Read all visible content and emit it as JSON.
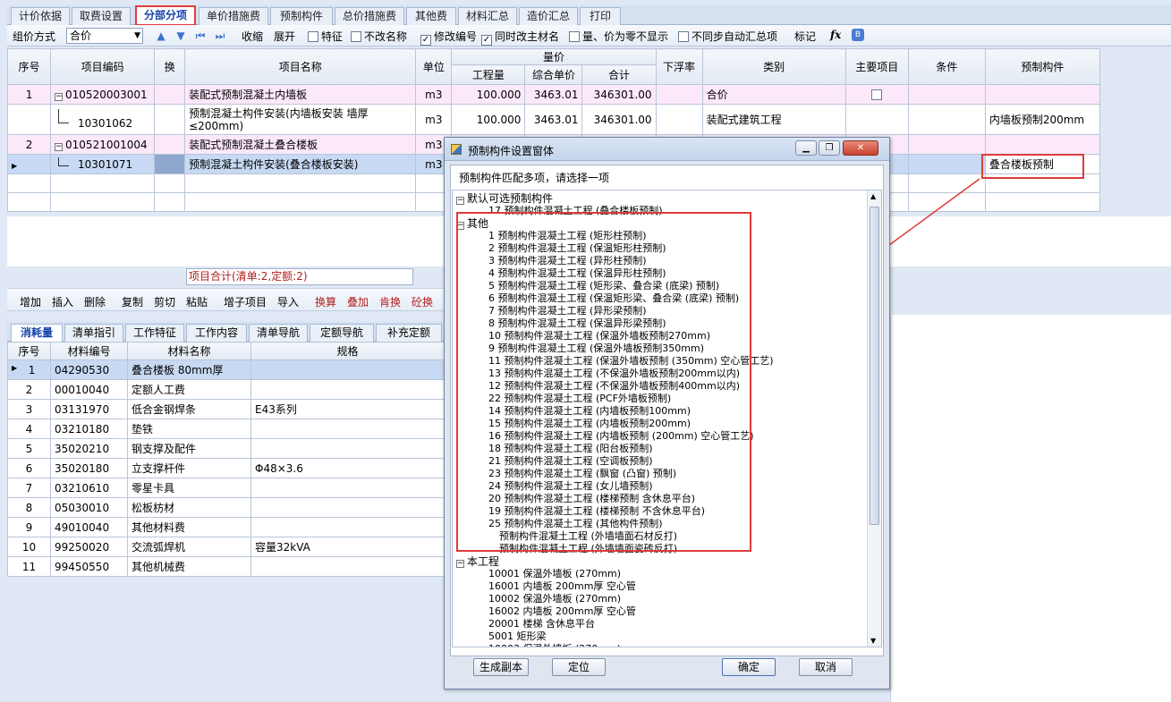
{
  "tabs": [
    "计价依据",
    "取费设置",
    "分部分项",
    "单价措施费",
    "预制构件",
    "总价措施费",
    "其他费",
    "材料汇总",
    "造价汇总",
    "打印"
  ],
  "active_tab": "分部分项",
  "toolbar": {
    "group_label": "组价方式",
    "group_value": "合价",
    "collapse": "收缩",
    "expand": "展开",
    "chk_feature": "特征",
    "chk_nochange_name": "不改名称",
    "chk_modify_code": "修改编号",
    "chk_modify_main": "同时改主材名",
    "chk_zero_hide": "量、价为零不显示",
    "chk_nosync": "不同步自动汇总项",
    "mark": "标记",
    "fx": "fx"
  },
  "grid": {
    "headers": {
      "seq": "序号",
      "code": "项目编码",
      "swap": "换",
      "name": "项目名称",
      "unit": "单位",
      "qty_group": "量价",
      "qty": "工程量",
      "price": "综合单价",
      "total": "合计",
      "float": "下浮率",
      "category": "类别",
      "main": "主要项目",
      "cond": "条件",
      "prefab": "预制构件"
    },
    "rows": [
      {
        "seq": "1",
        "code": "010520003001",
        "name": "装配式预制混凝土内墙板",
        "unit": "m3",
        "qty": "100.000",
        "price": "3463.01",
        "total": "346301.00",
        "category": "合价",
        "prefab": ""
      },
      {
        "seq": "",
        "code": "10301062",
        "name": "预制混凝土构件安装(内墙板安装 墙厚≤200mm)",
        "unit": "m3",
        "qty": "100.000",
        "price": "3463.01",
        "total": "346301.00",
        "category": "装配式建筑工程",
        "prefab": "内墙板预制200mm"
      },
      {
        "seq": "2",
        "code": "010521001004",
        "name": "装配式预制混凝土叠合楼板",
        "unit": "m3",
        "qty": "",
        "price": "",
        "total": "",
        "category": "",
        "prefab": ""
      },
      {
        "seq": "",
        "code": "10301071",
        "name": "预制混凝土构件安装(叠合楼板安装)",
        "unit": "m3",
        "qty": "",
        "price": "",
        "total": "",
        "category": "",
        "prefab": "叠合楼板预制"
      }
    ]
  },
  "status_total": "项目合计(清单:2,定额:2)",
  "toolbar2": [
    "增加",
    "插入",
    "删除",
    "复制",
    "剪切",
    "粘贴",
    "增子项目",
    "导入",
    "换算",
    "叠加",
    "肯换",
    "砼换"
  ],
  "tabs2": [
    "消耗量",
    "清单指引",
    "工作特征",
    "工作内容",
    "清单导航",
    "定额导航",
    "补充定额"
  ],
  "materials": {
    "headers": {
      "seq": "序号",
      "code": "材料编号",
      "name": "材料名称",
      "spec": "规格"
    },
    "rows": [
      {
        "seq": "1",
        "code": "04290530",
        "name": "叠合楼板 80mm厚",
        "spec": ""
      },
      {
        "seq": "2",
        "code": "00010040",
        "name": "定额人工费",
        "spec": ""
      },
      {
        "seq": "3",
        "code": "03131970",
        "name": "低合金钢焊条",
        "spec": "E43系列"
      },
      {
        "seq": "4",
        "code": "03210180",
        "name": "垫铁",
        "spec": ""
      },
      {
        "seq": "5",
        "code": "35020210",
        "name": "钢支撑及配件",
        "spec": ""
      },
      {
        "seq": "6",
        "code": "35020180",
        "name": "立支撑杆件",
        "spec": "Φ48×3.6"
      },
      {
        "seq": "7",
        "code": "03210610",
        "name": "零星卡具",
        "spec": ""
      },
      {
        "seq": "8",
        "code": "05030010",
        "name": "松板枋材",
        "spec": ""
      },
      {
        "seq": "9",
        "code": "49010040",
        "name": "其他材料费",
        "spec": ""
      },
      {
        "seq": "10",
        "code": "99250020",
        "name": "交流弧焊机",
        "spec": "容量32kVA"
      },
      {
        "seq": "11",
        "code": "99450550",
        "name": "其他机械费",
        "spec": ""
      }
    ]
  },
  "dialog": {
    "title": "预制构件设置窗体",
    "prompt": "预制构件匹配多项，请选择一项",
    "default_group": "默认可选预制构件",
    "default_items": [
      "17   预制构件混凝土工程 (叠合楼板预制)"
    ],
    "other_group": "其他",
    "other_items": [
      "1   预制构件混凝土工程 (矩形柱预制)",
      "2   预制构件混凝土工程 (保温矩形柱预制)",
      "3   预制构件混凝土工程 (异形柱预制)",
      "4   预制构件混凝土工程 (保温异形柱预制)",
      "5   预制构件混凝土工程 (矩形梁、叠合梁 (底梁) 预制)",
      "6   预制构件混凝土工程 (保温矩形梁、叠合梁 (底梁) 预制)",
      "7   预制构件混凝土工程 (异形梁预制)",
      "8   预制构件混凝土工程 (保温异形梁预制)",
      "10   预制构件混凝土工程 (保温外墙板预制270mm)",
      "9   预制构件混凝土工程 (保温外墙板预制350mm)",
      "11   预制构件混凝土工程 (保温外墙板预制 (350mm) 空心管工艺)",
      "13   预制构件混凝土工程 (不保温外墙板预制200mm以内)",
      "12   预制构件混凝土工程 (不保温外墙板预制400mm以内)",
      "22   预制构件混凝土工程 (PCF外墙板预制)",
      "14   预制构件混凝土工程 (内墙板预制100mm)",
      "15   预制构件混凝土工程 (内墙板预制200mm)",
      "16   预制构件混凝土工程 (内墙板预制 (200mm) 空心管工艺)",
      "18   预制构件混凝土工程 (阳台板预制)",
      "21   预制构件混凝土工程 (空调板预制)",
      "23   预制构件混凝土工程 (飘窗 (凸窗) 预制)",
      "24   预制构件混凝土工程 (女儿墙预制)",
      "20   预制构件混凝土工程 (楼梯预制 含休息平台)",
      "19   预制构件混凝土工程 (楼梯预制 不含休息平台)",
      "25   预制构件混凝土工程 (其他构件预制)",
      "预制构件混凝土工程 (外墙墙面石材反打)",
      "预制构件混凝土工程 (外墙墙面瓷砖反打)"
    ],
    "project_group": "本工程",
    "project_items": [
      "10001   保温外墙板 (270mm)",
      "16001   内墙板 200mm厚 空心管",
      "10002   保温外墙板 (270mm)",
      "16002   内墙板 200mm厚 空心管",
      "20001   楼梯 含休息平台",
      "5001   矩形梁",
      "10003   保温外墙板 (270mm)"
    ],
    "buttons": {
      "gen": "生成副本",
      "locate": "定位",
      "ok": "确定",
      "cancel": "取消"
    }
  },
  "colors": {
    "highlight_red": "#e03a3a",
    "pink_row": "#fbe9fa",
    "selected_row": "#c7d9f3"
  }
}
